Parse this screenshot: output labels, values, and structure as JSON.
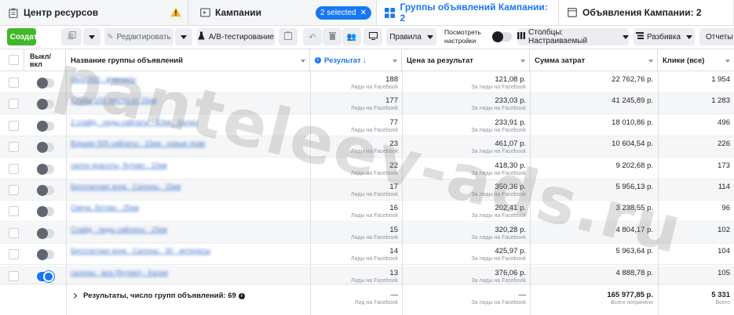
{
  "tabs": [
    {
      "label": "Центр ресурсов"
    },
    {
      "label": "Кампании",
      "badge": "2 selected"
    },
    {
      "label": "Группы объявлений Кампании: 2"
    },
    {
      "label": "Объявления Кампании: 2"
    }
  ],
  "toolbar": {
    "create": "Создать",
    "edit": "Редактировать",
    "ab_test": "A/B-тестирование",
    "rules": "Правила",
    "view_settings_line1": "Посмотреть",
    "view_settings_line2": "настройки",
    "columns": "Столбцы: Настраиваемый",
    "breakdown": "Разбивка",
    "reports": "Отчеты"
  },
  "table": {
    "headers": {
      "toggle_line1": "Выкл/",
      "toggle_line2": "вкл",
      "name": "Название группы объявлений",
      "result": "Результат ↓",
      "cost": "Цена за результат",
      "spend": "Сумма затрат",
      "clicks": "Клики (все)"
    },
    "rows": [
      {
        "name": "сило 555 · мужчины",
        "result": "188",
        "result_sub": "Лиды на Facebook",
        "cost": "121,08 р.",
        "cost_sub": "За лиды на Facebook",
        "spend": "22 762,76 р.",
        "clicks": "1 954",
        "on": false
      },
      {
        "name": "Слайд 100 тексты от 15км",
        "result": "177",
        "result_sub": "Лиды на Facebook",
        "cost": "233,03 р.",
        "cost_sub": "За лиды на Facebook",
        "spend": "41 245,89 р.",
        "clicks": "1 283",
        "on": false
      },
      {
        "name": "2 слайд · лиды сайлаты · 10км · Калин",
        "result": "77",
        "result_sub": "Лиды на Facebook",
        "cost": "233,91 р.",
        "cost_sub": "За лиды на Facebook",
        "spend": "18 010,86 р.",
        "clicks": "496",
        "on": false
      },
      {
        "name": "Взрывн 555 сайлаты · 15км · новые прав",
        "result": "23",
        "result_sub": "Лиды на Facebook",
        "cost": "461,07 р.",
        "cost_sub": "За лиды на Facebook",
        "spend": "10 604,54 р.",
        "clicks": "226",
        "on": false
      },
      {
        "name": "салон красоты, бутово · 10км",
        "result": "22",
        "result_sub": "Лиды на Facebook",
        "cost": "418,30 р.",
        "cost_sub": "За лиды на Facebook",
        "spend": "9 202,68 р.",
        "clicks": "173",
        "on": false
      },
      {
        "name": "Бесплатная зона · Салоны · 15км",
        "result": "17",
        "result_sub": "Лиды на Facebook",
        "cost": "350,36 р.",
        "cost_sub": "За лиды на Facebook",
        "spend": "5 956,13 р.",
        "clicks": "114",
        "on": false
      },
      {
        "name": "Свечи, бутово · 25км",
        "result": "16",
        "result_sub": "Лиды на Facebook",
        "cost": "202,41 р.",
        "cost_sub": "За лиды на Facebook",
        "spend": "3 238,55 р.",
        "clicks": "96",
        "on": false
      },
      {
        "name": "Слайд · лиды сайлаты · 15км",
        "result": "15",
        "result_sub": "Лиды на Facebook",
        "cost": "320,28 р.",
        "cost_sub": "За лиды на Facebook",
        "spend": "4 804,17 р.",
        "clicks": "102",
        "on": false
      },
      {
        "name": "Бесплатная зона · Салоны · 30 · интересы",
        "result": "14",
        "result_sub": "Лиды на Facebook",
        "cost": "425,97 р.",
        "cost_sub": "За лиды на Facebook",
        "spend": "5 963,64 р.",
        "clicks": "104",
        "on": false
      },
      {
        "name": "салоны · мск (бутово) · Калия",
        "result": "13",
        "result_sub": "Лиды на Facebook",
        "cost": "376,06 р.",
        "cost_sub": "За лиды на Facebook",
        "spend": "4 888,78 р.",
        "clicks": "105",
        "on": true
      }
    ],
    "footer": {
      "label": "Результаты, число групп объявлений: 69",
      "result": "—",
      "result_sub": "Лид на Facebook",
      "cost": "—",
      "cost_sub": "За лиды на Facebook",
      "spend": "165 977,85 р.",
      "spend_sub": "Всего потрачено",
      "clicks": "5 331",
      "clicks_sub": "Всего"
    }
  },
  "watermark": "panteleev-ads.ru",
  "colors": {
    "accent": "#1877f2",
    "create": "#42b72a",
    "warning": "#f7b928"
  }
}
